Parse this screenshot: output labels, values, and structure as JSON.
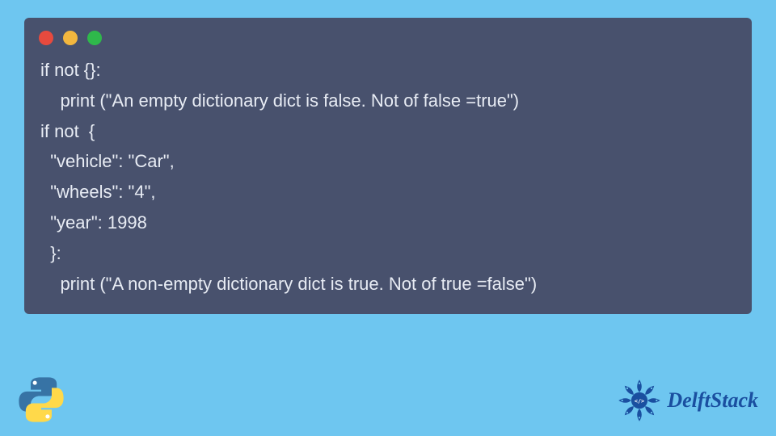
{
  "code": {
    "lines": [
      "if not {}:",
      "    print (\"An empty dictionary dict is false. Not of false =true\")",
      "if not  {",
      "  \"vehicle\": \"Car\",",
      "  \"wheels\": \"4\",",
      "  \"year\": 1998",
      "  }:",
      "    print (\"A non-empty dictionary dict is true. Not of true =false\")"
    ]
  },
  "brand": {
    "name": "DelftStack"
  },
  "colors": {
    "page_bg": "#6ec6f0",
    "window_bg": "#48516d",
    "code_fg": "#e8ecf4",
    "dot_red": "#e74a3e",
    "dot_yellow": "#f3b73e",
    "dot_green": "#2fb84b",
    "brand_text": "#1a4fa0"
  }
}
